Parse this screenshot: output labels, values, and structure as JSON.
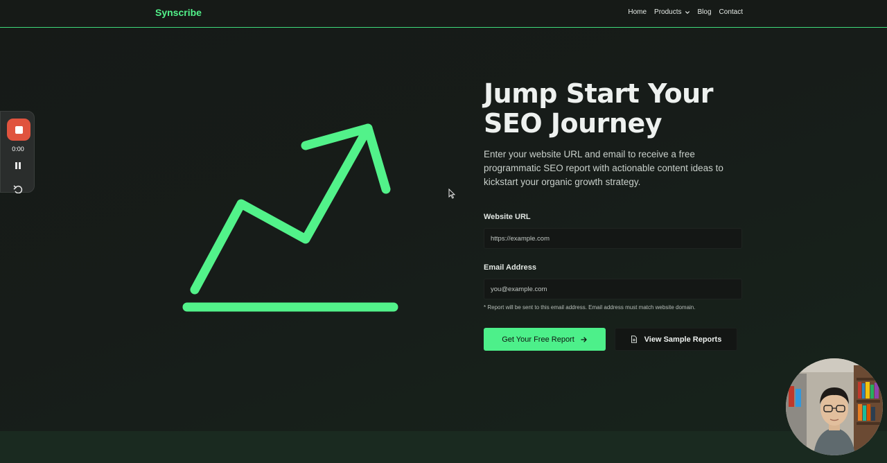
{
  "nav": {
    "brand": "Synscribe",
    "links": [
      "Home",
      "Products",
      "Blog",
      "Contact"
    ]
  },
  "recorder": {
    "time": "0:00"
  },
  "hero": {
    "title": "Jump Start Your SEO Journey",
    "description": "Enter your website URL and email to receive a free programmatic SEO report with actionable content ideas to kickstart your organic growth strategy."
  },
  "form": {
    "website_label": "Website URL",
    "website_placeholder": "https://example.com",
    "email_label": "Email Address",
    "email_placeholder": "you@example.com",
    "hint": "* Report will be sent to this email address. Email address must match website domain.",
    "submit_label": "Get Your Free Report",
    "sample_label": "View Sample Reports"
  },
  "colors": {
    "accent": "#4df08a",
    "background": "#161a17",
    "record": "#e0533e"
  },
  "icons": {
    "products": "chevron-down-icon",
    "submit": "arrow-right-icon",
    "sample": "document-icon",
    "hero": "trend-up-arrow-icon"
  }
}
